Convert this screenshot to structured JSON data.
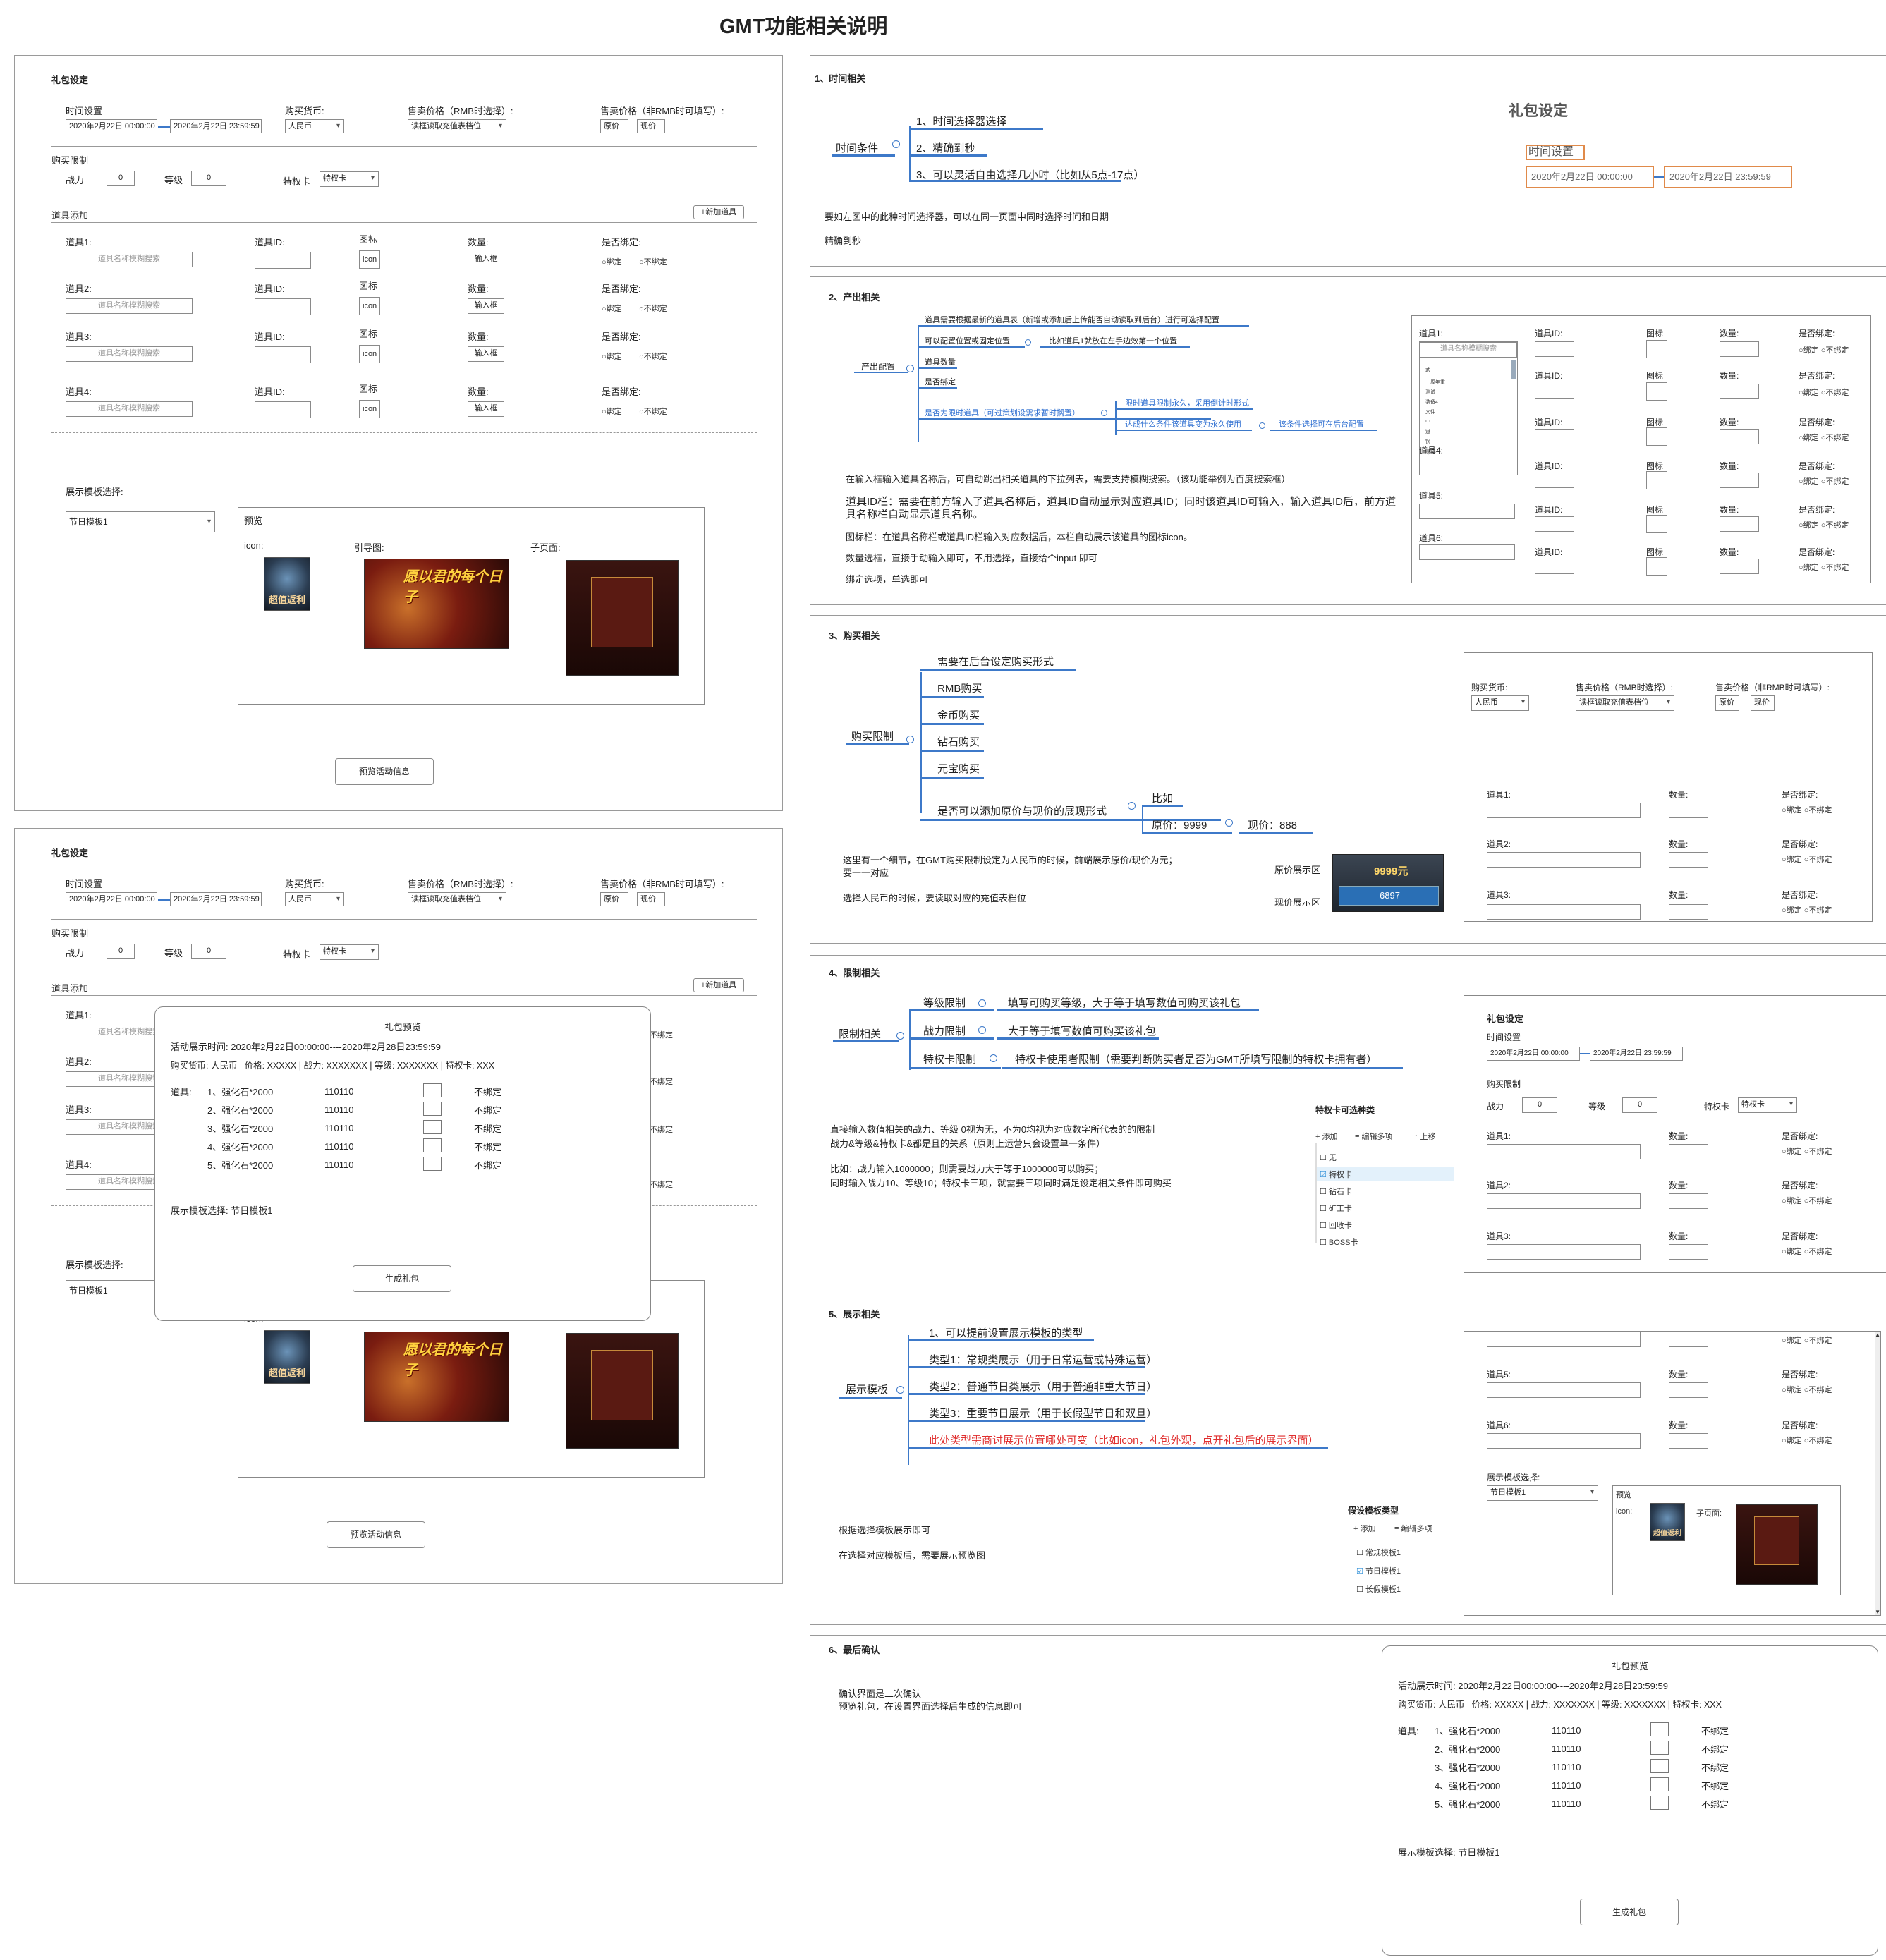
{
  "title": "GMT功能相关说明",
  "form": {
    "heading": "礼包设定",
    "time_label": "时间设置",
    "start": "2020年2月22日 00:00:00",
    "end": "2020年2月22日 23:59:59",
    "currency_label": "购买货币:",
    "currency": "人民币",
    "price_rmb_label": "售卖价格（RMB时选择）:",
    "price_rmb": "读框读取充值表档位",
    "price_other_label": "售卖价格（非RMB时可填写）:",
    "orig": "原价",
    "now": "现价",
    "limit_label": "购买限制",
    "power": "战力",
    "power_val": "0",
    "level": "等级",
    "level_val": "0",
    "vip": "特权卡",
    "vip_val": "特权卡",
    "items_label": "道具添加",
    "add_btn": "+新加道具",
    "items": [
      "道具1:",
      "道具2:",
      "道具3:",
      "道具4:"
    ],
    "item_id": "道具ID:",
    "icon_hd": "图标",
    "icon": "icon",
    "qty": "数量:",
    "qty_val": "输入框",
    "bind_q": "是否绑定:",
    "bind": "绑定",
    "unbind": "不绑定",
    "search_ph": "道具名称模糊搜索",
    "tpl_label": "展示模板选择:",
    "tpl": "节日模板1",
    "preview": "预览",
    "icon_label": "icon:",
    "guide": "引导图:",
    "child": "子页面:",
    "preview_btn": "预览活动信息",
    "icon_text": "超值返利",
    "banner_text": "愿以君的每个日子"
  },
  "dialog": {
    "title": "礼包预览",
    "time": "活动展示时间:    2020年2月22日00:00:00----2020年2月28日23:59:59",
    "info": "购买货币:      人民币    |  价格: XXXXX    |  战力: XXXXXXX     |  等级: XXXXXXX     |  特权卡: XXX",
    "items_label": "道具:",
    "items": [
      "1、强化石*2000",
      "2、强化石*2000",
      "3、强化石*2000",
      "4、强化石*2000",
      "5、强化石*2000"
    ],
    "ids": "110110",
    "unbind": "不绑定",
    "tpl": "展示模板选择: 节日模板1",
    "gen": "生成礼包"
  },
  "s1": {
    "title": "1、时间相关",
    "root": "时间条件",
    "b": [
      "1、时间选择器选择",
      "2、精确到秒",
      "3、可以灵活自由选择几小时（比如从5点-17点）"
    ],
    "n1": "要如左图中的此种时间选择器，可以在同一页面中同时选择时间和日期",
    "n2": "精确到秒",
    "side_title": "礼包设定",
    "side_time": "时间设置",
    "side_start": "2020年2月22日 00:00:00",
    "side_end": "2020年2月22日 23:59:59"
  },
  "s2": {
    "title": "2、产出相关",
    "root": "产出配置",
    "b": [
      "道具需要根据最新的道具表（新增或添加后上传能否自动读取到后台）进行可选择配置",
      "可以配置位置或固定位置",
      "比如道具1就放在左手边效第一个位置",
      "道具数量",
      "是否绑定",
      "是否为限时道具（可过策划设需求暂时搁置）",
      "限时道具限制永久，采用倒计时形式",
      "达成什么条件该道具变为永久使用",
      "该条件选择可在后台配置"
    ],
    "n": [
      "在输入框输入道具名称后，可自动跳出相关道具的下拉列表，需要支持模糊搜索。（该功能举例为百度搜索框）",
      "道具ID栏：需要在前方输入了道具名称后，道具ID自动显示对应道具ID；同时该道具ID可输入，输入道具ID后，前方道具名称栏自动显示道具名称。",
      "图标栏：在道具名称栏或道具ID栏输入对应数据后，本栏自动展示该道具的图标icon。",
      "数量选框，直接手动输入即可，不用选择，直接给个input 即可",
      "绑定选项，单选即可"
    ],
    "items": [
      "道具1:",
      "道具2:",
      "道具3:",
      "道具4:",
      "道具5:",
      "道具6:"
    ],
    "dd": [
      "武",
      "十周年重",
      "测试",
      "装备4",
      "文件",
      "中",
      "道",
      "钢",
      "测试"
    ]
  },
  "s3": {
    "title": "3、购买相关",
    "root": "购买限制",
    "b": [
      "需要在后台设定购买形式",
      "RMB购买",
      "金币购买",
      "钻石购买",
      "元宝购买",
      "是否可以添加原价与现价的展现形式"
    ],
    "eg": "比如",
    "orig": "原价：9999",
    "now": "现价：888",
    "n1": "这里有一个细节，在GMT购买限制设定为人民币的时候，前端展示原价/现价为元；",
    "n1b": "要一一对应",
    "n2": "选择人民币的时候，要读取对应的充值表档位",
    "orig_area": "原价展示区",
    "now_area": "现价展示区",
    "orig_img": "9999元",
    "now_img": "6897",
    "items": [
      "道具1:",
      "道具2:",
      "道具3:"
    ]
  },
  "s4": {
    "title": "4、限制相关",
    "root": "限制相关",
    "b": [
      "等级限制",
      "战力限制",
      "特权卡限制"
    ],
    "d": [
      "填写可购买等级，大于等于填写数值可购买该礼包",
      "大于等于填写数值可购买该礼包",
      "特权卡使用者限制（需要判断购买者是否为GMT所填写限制的特权卡拥有者）"
    ],
    "n1": "直接输入数值相关的战力、等级   0视为无，不为0均视为对应数字所代表的的限制",
    "n1b": "战力&等级&特权卡&都是且的关系（原则上运营只会设置单一条件）",
    "n2": "比如：战力输入1000000；则需要战力大于等于1000000可以购买；",
    "n2b": "同时输入战力10、等级10；特权卡三项，就需要三项同时满足设定相关条件即可购买",
    "vip_title": "特权卡可选种类",
    "tb": [
      "+ 添加",
      "≡ 编辑多项",
      "↑ 上移"
    ],
    "vips": [
      "无",
      "特权卡",
      "钻石卡",
      "矿工卡",
      "回收卡",
      "BOSS卡"
    ],
    "items": [
      "道具1:",
      "道具2:",
      "道具3:"
    ]
  },
  "s5": {
    "title": "5、展示相关",
    "root": "展示模板",
    "b": [
      "1、可以提前设置展示模板的类型",
      "类型1：常规类展示（用于日常运营或特殊运营）",
      "类型2：普通节日类展示（用于普通非重大节日）",
      "类型3：重要节日展示（用于长假型节日和双旦）",
      "此处类型需商讨展示位置哪处可变（比如icon，礼包外观，点开礼包后的展示界面）"
    ],
    "n1": "根据选择模板展示即可",
    "n2": "在选择对应模板后，需要展示预览图",
    "tpl_title": "假设模板类型",
    "tb": [
      "+ 添加",
      "≡ 编辑多项"
    ],
    "tpls": [
      "常规模板1",
      "节日模板1",
      "长假模板1"
    ],
    "items": [
      "道具5:",
      "道具6:"
    ]
  },
  "s6": {
    "title": "6、最后确认",
    "n1": "确认界面是二次确认",
    "n2": "预览礼包，在设置界面选择后生成的信息即可"
  },
  "colors": {
    "accent": "#3d79c9",
    "red": "#e03030",
    "highlight": "#e08a4a"
  }
}
